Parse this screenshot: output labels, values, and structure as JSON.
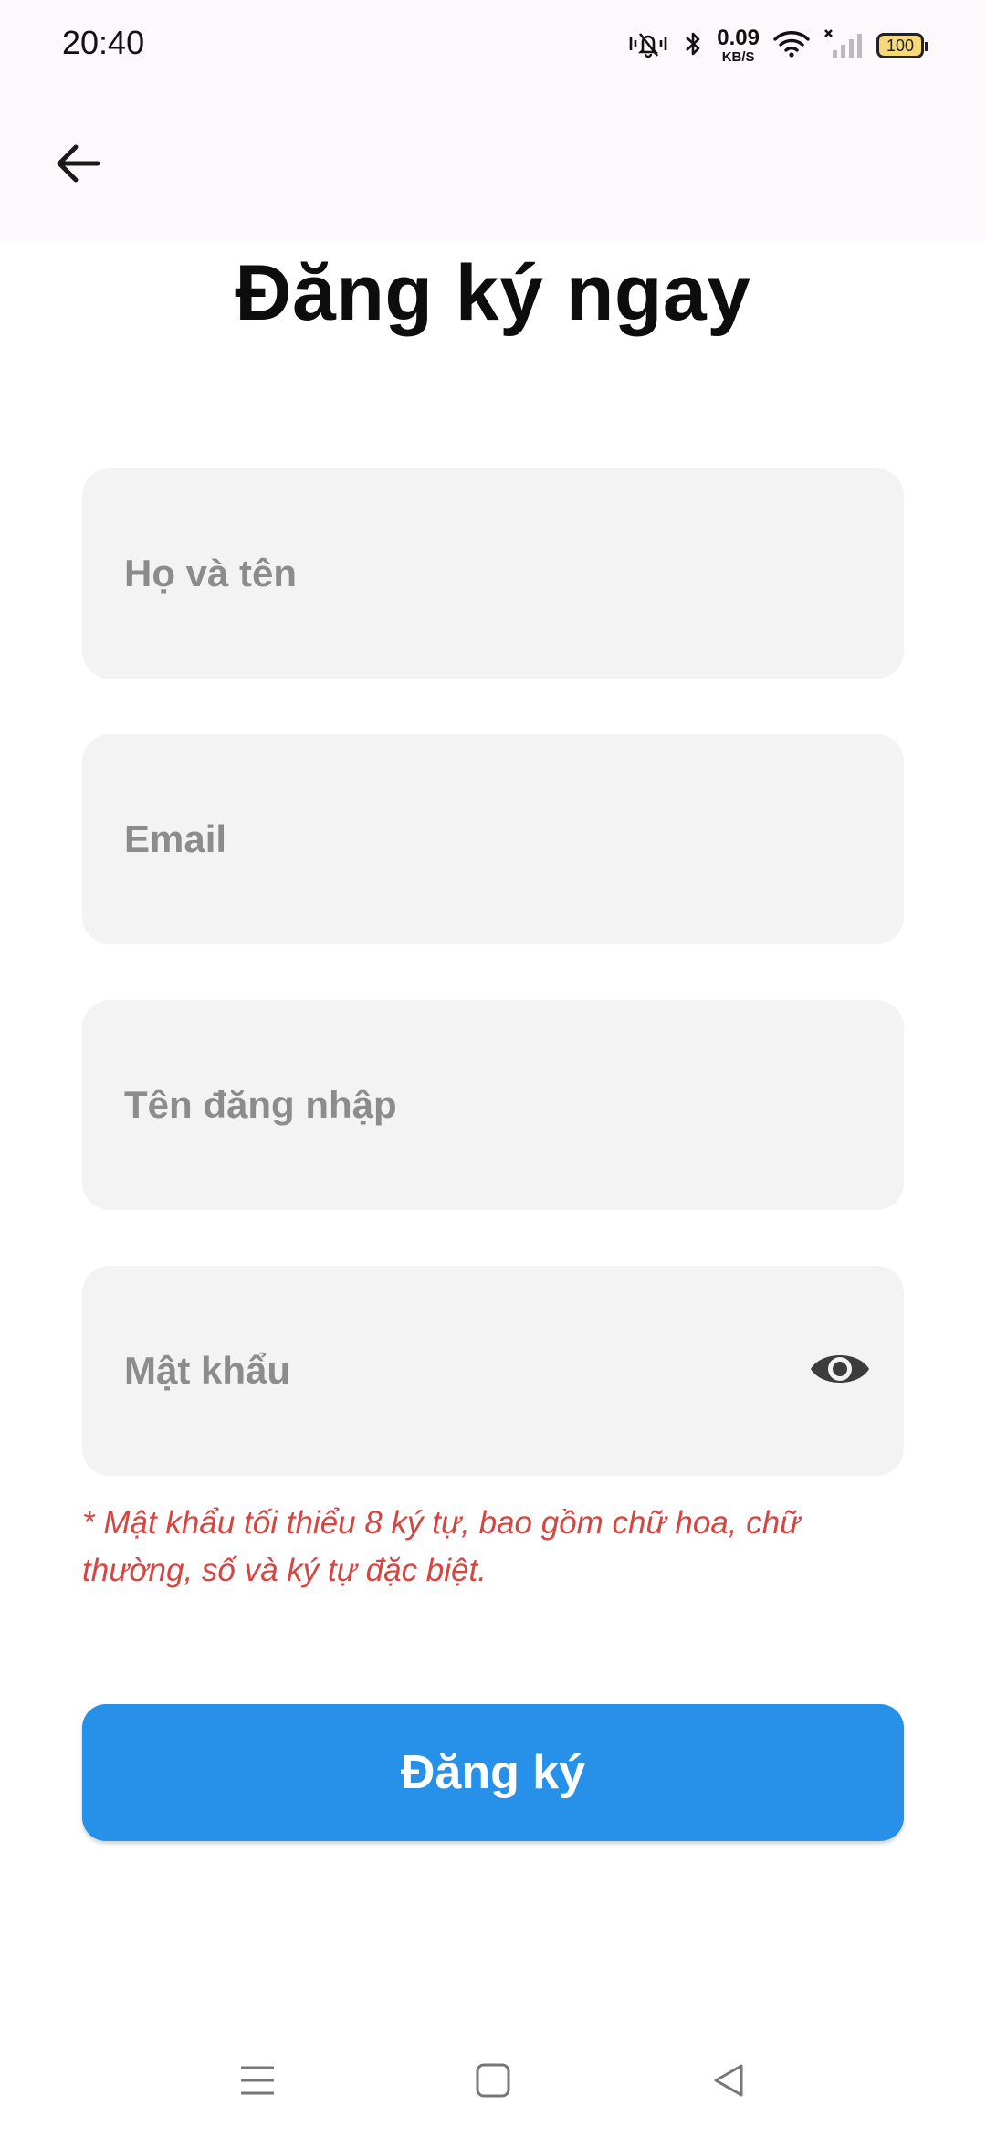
{
  "status_bar": {
    "time": "20:40",
    "net_speed_value": "0.09",
    "net_speed_unit": "KB/S",
    "battery": "100",
    "icons": [
      "mute-vibrate-icon",
      "bluetooth-icon",
      "wifi-icon",
      "signal-icon",
      "battery-icon"
    ]
  },
  "app_bar": {
    "back_icon": "arrow-left-icon"
  },
  "page": {
    "title": "Đăng ký ngay"
  },
  "form": {
    "full_name_placeholder": "Họ và tên",
    "email_placeholder": "Email",
    "username_placeholder": "Tên đăng nhập",
    "password_placeholder": "Mật khẩu",
    "password_toggle_icon": "eye-icon",
    "password_hint": "* Mật khẩu tối thiểu 8 ký tự, bao gồm chữ hoa, chữ thường, số và ký tự đặc biệt.",
    "submit_label": "Đăng ký"
  },
  "colors": {
    "primary": "#2791ea",
    "hint": "#d64541",
    "field_bg": "#f3f3f3",
    "appbar_bg": "#fdf8fb"
  },
  "nav_bar": {
    "items": [
      "menu-icon",
      "home-icon",
      "back-triangle-icon"
    ]
  }
}
